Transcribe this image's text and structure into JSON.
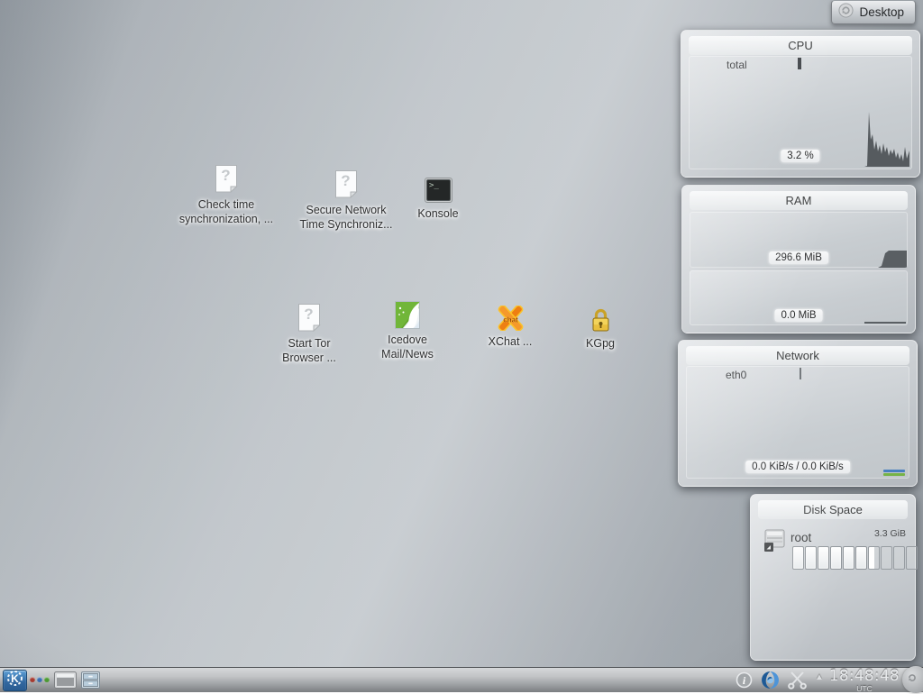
{
  "colors": {
    "kde_blue": "#3b74ac",
    "legend_download": "#477fc0",
    "legend_upload": "#76b347"
  },
  "desktop": {
    "toolbox_label": "Desktop",
    "icons": [
      {
        "id": "check-time",
        "label": "Check time\nsynchronization, ...",
        "icon": "unknown-document-icon"
      },
      {
        "id": "secure-time",
        "label": "Secure Network\nTime Synchroniz...",
        "icon": "unknown-document-icon"
      },
      {
        "id": "konsole",
        "label": "Konsole",
        "icon": "terminal-icon"
      },
      {
        "id": "tor-browser",
        "label": "Start Tor\nBrowser ...",
        "icon": "unknown-document-icon"
      },
      {
        "id": "icedove",
        "label": "Icedove\nMail/News",
        "icon": "icedove-bird-icon"
      },
      {
        "id": "xchat",
        "label": "XChat ...",
        "icon": "xchat-x-icon"
      },
      {
        "id": "kgpg",
        "label": "KGpg",
        "icon": "padlock-icon"
      }
    ]
  },
  "widgets": {
    "cpu": {
      "title": "CPU",
      "row_label": "total",
      "value_label": "3.2 %",
      "cpu_percent": 3.2
    },
    "ram": {
      "title": "RAM",
      "used_label": "296.6 MiB",
      "swap_label": "0.0 MiB",
      "used_mib": 296.6,
      "swap_mib": 0.0
    },
    "network": {
      "title": "Network",
      "row_label": "eth0",
      "value_label": "0.0 KiB/s / 0.0 KiB/s",
      "down_kibs": 0.0,
      "up_kibs": 0.0,
      "legend_colors": [
        "#477fc0",
        "#76b347"
      ]
    },
    "disk": {
      "title": "Disk Space",
      "mount_label": "root",
      "size_label": "3.3 GiB",
      "segments": [
        1,
        1,
        1,
        1,
        1,
        1,
        0.55,
        0,
        0,
        0
      ]
    }
  },
  "taskbar": {
    "clock": {
      "time": "18:48:48",
      "zone": "UTC"
    },
    "icon_names": {
      "launcher": "kde-menu-icon",
      "activities": "activities-dots-icon",
      "show_desktop": "show-desktop-icon",
      "file_cabinet": "file-cabinet-icon",
      "notifications": "info-icon",
      "timesync": "blue-swirl-icon",
      "clipboard": "scissors-icon",
      "tray_expand": "up-arrow-icon",
      "panel_toolbox": "cashew-icon"
    }
  }
}
